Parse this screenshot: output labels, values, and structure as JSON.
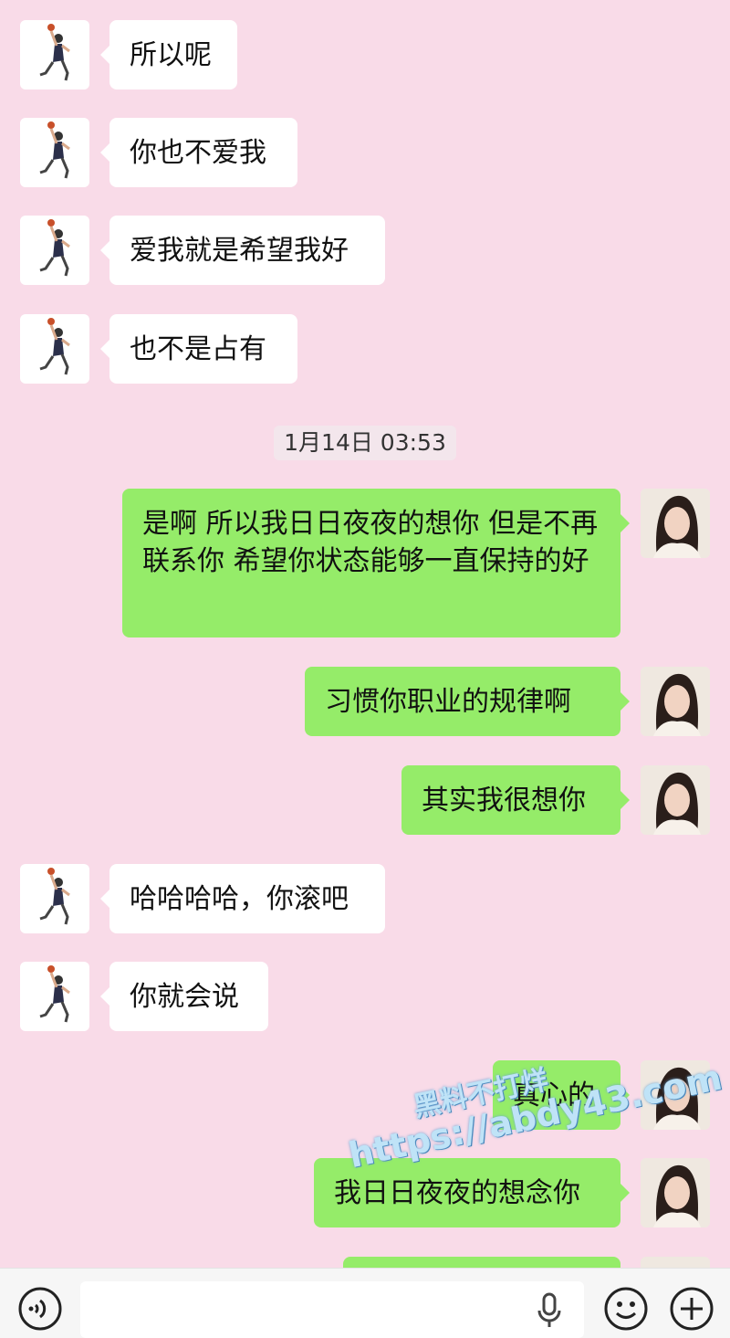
{
  "messages": [
    {
      "side": "left",
      "text": "所以呢"
    },
    {
      "side": "left",
      "text": "你也不爱我"
    },
    {
      "side": "left",
      "text": "爱我就是希望我好"
    },
    {
      "side": "left",
      "text": "也不是占有"
    },
    {
      "side": "right",
      "text": "是啊 所以我日日夜夜的想你 但是不再联系你 希望你状态能够一直保持的好"
    },
    {
      "side": "right",
      "text": "习惯你职业的规律啊"
    },
    {
      "side": "right",
      "text": "其实我很想你"
    },
    {
      "side": "left",
      "text": "哈哈哈哈，你滚吧"
    },
    {
      "side": "left",
      "text": "你就会说"
    },
    {
      "side": "right",
      "text": "真心的"
    },
    {
      "side": "right",
      "text": "我日日夜夜的想念你"
    }
  ],
  "timestamp": "1月14日 03:53",
  "watermark": {
    "line1": "黑料不打烊",
    "line2": "https://abdy43.com"
  },
  "input": {
    "placeholder": ""
  },
  "icons": {
    "voice": "voice-toggle-icon",
    "mic": "microphone-icon",
    "emoji": "emoji-icon",
    "more": "plus-icon"
  },
  "colors": {
    "background": "#f9dbe8",
    "sent_bubble": "#95ec69",
    "received_bubble": "#ffffff"
  }
}
